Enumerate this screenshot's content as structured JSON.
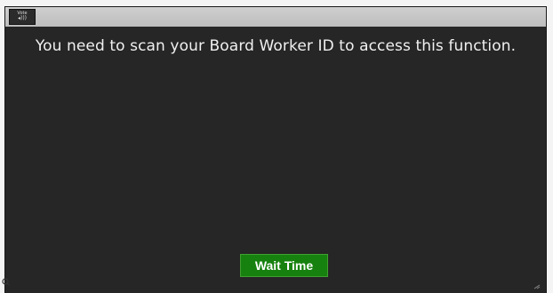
{
  "titlebar": {
    "widget_line1": "Vote",
    "widget_line2": "◂)))",
    "widget_icon": "audio-status-icon"
  },
  "main": {
    "message": "You need to scan your Board Worker ID to access this function."
  },
  "actions": {
    "wait_time_label": "Wait Time"
  },
  "colors": {
    "screen_background": "#262626",
    "titlebar": "#c8c8c8",
    "button_background": "#17810f",
    "message_text": "#f0f0f0"
  },
  "icons": {
    "bottom_left": "search-icon",
    "bottom_right": "resize-grip-icon"
  }
}
